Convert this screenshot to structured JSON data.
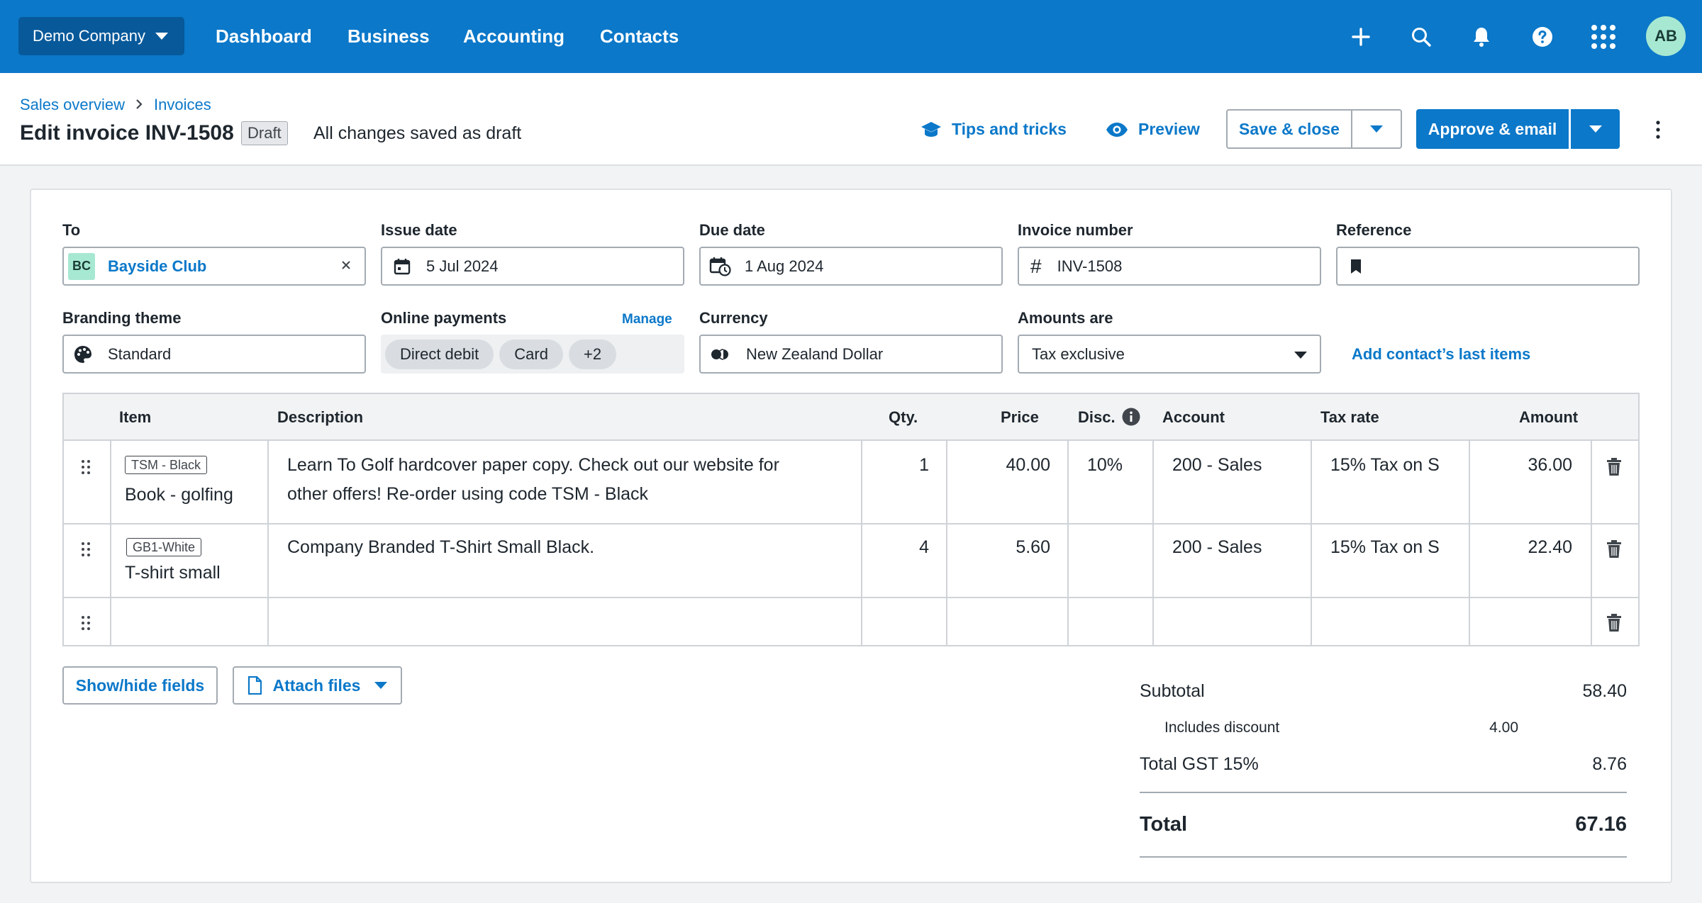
{
  "nav": {
    "org": "Demo Company",
    "links": [
      "Dashboard",
      "Business",
      "Accounting",
      "Contacts"
    ],
    "avatar": "AB"
  },
  "header": {
    "breadcrumb": [
      "Sales overview",
      "Invoices"
    ],
    "title": "Edit invoice INV-1508",
    "badge": "Draft",
    "saved_status": "All changes saved as draft",
    "tips": "Tips and tricks",
    "preview": "Preview",
    "save_close": "Save & close",
    "approve_email": "Approve & email"
  },
  "form": {
    "to_label": "To",
    "contact_initials": "BC",
    "contact_name": "Bayside Club",
    "issue_label": "Issue date",
    "issue_value": "5 Jul 2024",
    "due_label": "Due date",
    "due_value": "1 Aug 2024",
    "invnum_label": "Invoice number",
    "invnum_value": "INV-1508",
    "reference_label": "Reference",
    "reference_value": "",
    "branding_label": "Branding theme",
    "branding_value": "Standard",
    "payments_label": "Online payments",
    "payments_manage": "Manage",
    "payments_pills": [
      "Direct debit",
      "Card",
      "+2"
    ],
    "currency_label": "Currency",
    "currency_value": "New Zealand Dollar",
    "amounts_label": "Amounts are",
    "amounts_value": "Tax exclusive",
    "add_last_items": "Add contact’s last items"
  },
  "table": {
    "headers": {
      "item": "Item",
      "description": "Description",
      "qty": "Qty.",
      "price": "Price",
      "disc": "Disc.",
      "account": "Account",
      "taxrate": "Tax rate",
      "amount": "Amount"
    },
    "rows": [
      {
        "code": "TSM - Black",
        "item": "Book - golfing",
        "desc1": "Learn To Golf hardcover paper copy.  Check out our website for",
        "desc2": "other offers! Re-order using code TSM - Black",
        "qty": "1",
        "price": "40.00",
        "disc": "10%",
        "account": "200 - Sales",
        "tax": "15% Tax on S",
        "amount": "36.00"
      },
      {
        "code": "GB1-White",
        "item": "T-shirt small",
        "desc1": "Company Branded T-Shirt Small Black.",
        "desc2": "",
        "qty": "4",
        "price": "5.60",
        "disc": "",
        "account": "200 - Sales",
        "tax": "15% Tax on S",
        "amount": "22.40"
      }
    ]
  },
  "actions": {
    "show_hide": "Show/hide fields",
    "attach": "Attach files"
  },
  "totals": {
    "subtotal_label": "Subtotal",
    "subtotal": "58.40",
    "discount_label": "Includes discount",
    "discount": "4.00",
    "gst_label": "Total GST 15%",
    "gst": "8.76",
    "total_label": "Total",
    "total": "67.16"
  },
  "colors": {
    "brand": "#0b78c9",
    "nav_dark": "#07599a",
    "avatar_bg": "#a7e8d2"
  }
}
